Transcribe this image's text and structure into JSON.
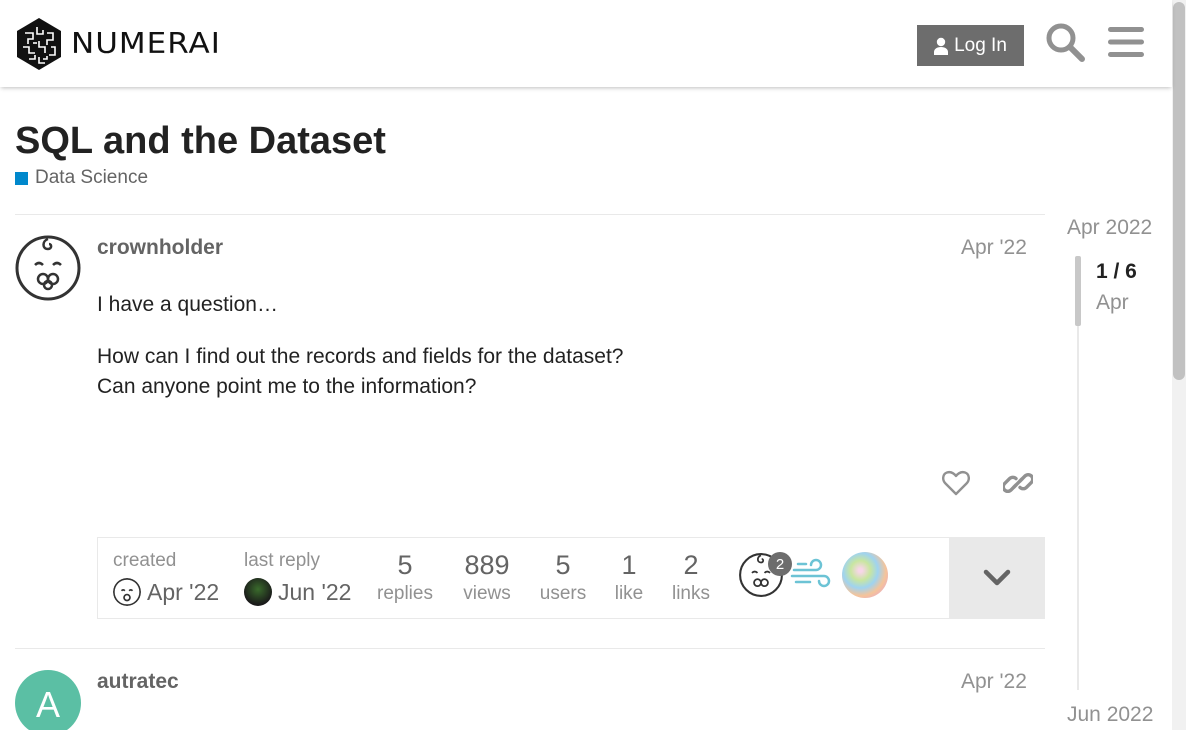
{
  "header": {
    "brand": "NUMERAI",
    "login_label": "Log In"
  },
  "topic": {
    "title": "SQL and the Dataset",
    "category": "Data Science",
    "category_color": "#0088cc"
  },
  "posts": [
    {
      "username": "crownholder",
      "date": "Apr '22",
      "paragraphs": [
        "I have a question…",
        "How can I find out the records and fields for the dataset?",
        "Can anyone point me to the information?"
      ]
    },
    {
      "username": "autratec",
      "date": "Apr '22",
      "avatar_letter": "A",
      "avatar_color": "#5bbfa4"
    }
  ],
  "topic_map": {
    "created_label": "created",
    "created_date": "Apr '22",
    "last_reply_label": "last reply",
    "last_reply_date": "Jun '22",
    "stats": [
      {
        "value": "5",
        "label": "replies"
      },
      {
        "value": "889",
        "label": "views"
      },
      {
        "value": "5",
        "label": "users"
      },
      {
        "value": "1",
        "label": "like"
      },
      {
        "value": "2",
        "label": "links"
      }
    ],
    "participant_count_badge": "2"
  },
  "timeline": {
    "start_date": "Apr 2022",
    "position": "1 / 6",
    "position_date": "Apr",
    "end_date": "Jun 2022"
  },
  "icons": [
    "logo-icon",
    "user-icon",
    "search-icon",
    "hamburger-menu-icon",
    "heart-icon",
    "link-icon",
    "chevron-down-icon"
  ]
}
